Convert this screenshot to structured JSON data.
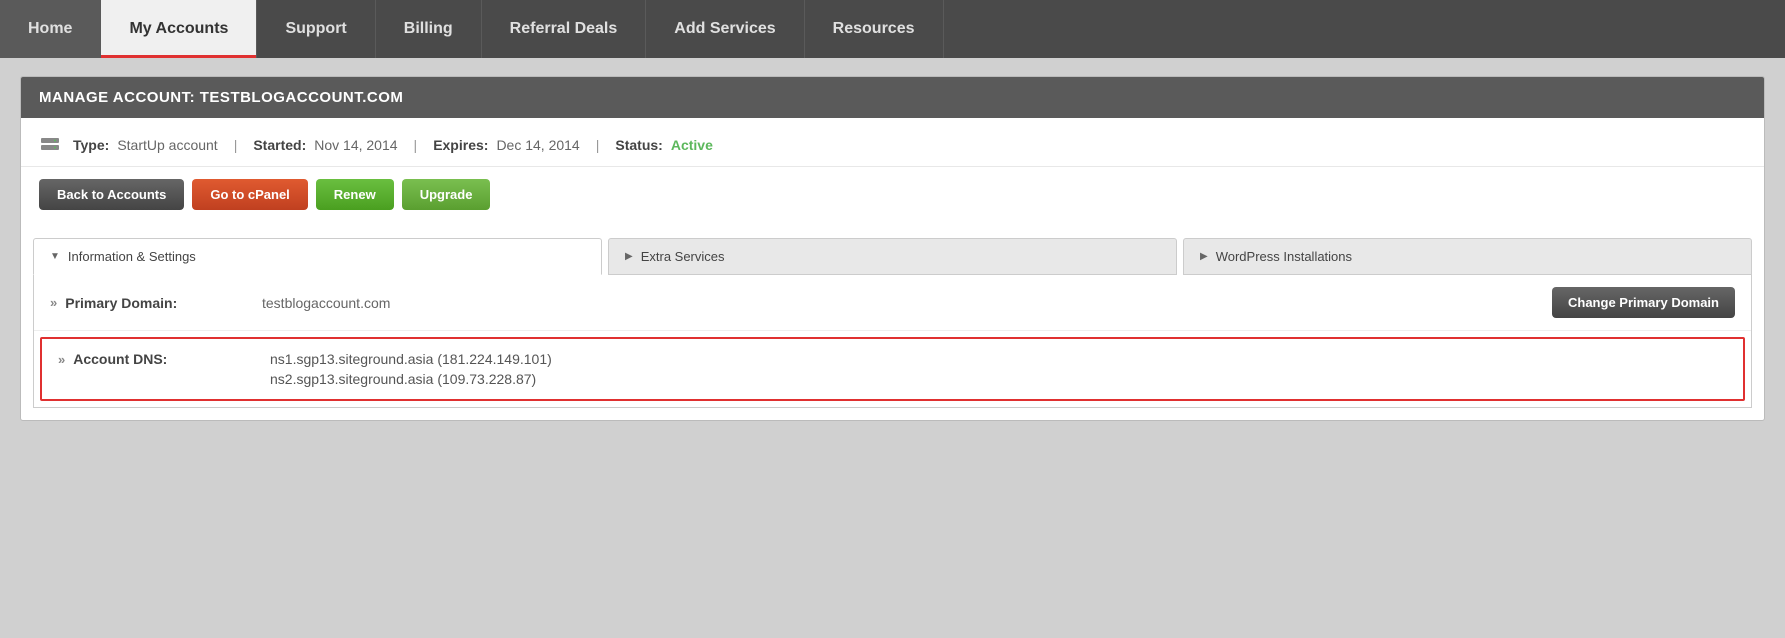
{
  "nav": {
    "tabs": [
      {
        "id": "home",
        "label": "Home",
        "active": false
      },
      {
        "id": "my-accounts",
        "label": "My Accounts",
        "active": true
      },
      {
        "id": "support",
        "label": "Support",
        "active": false
      },
      {
        "id": "billing",
        "label": "Billing",
        "active": false
      },
      {
        "id": "referral-deals",
        "label": "Referral Deals",
        "active": false
      },
      {
        "id": "add-services",
        "label": "Add Services",
        "active": false
      },
      {
        "id": "resources",
        "label": "Resources",
        "active": false
      }
    ]
  },
  "manage": {
    "header": "MANAGE ACCOUNT: TESTBLOGACCOUNT.COM",
    "type_label": "Type:",
    "type_value": "StartUp account",
    "started_label": "Started:",
    "started_value": "Nov 14, 2014",
    "expires_label": "Expires:",
    "expires_value": "Dec 14, 2014",
    "status_label": "Status:",
    "status_value": "Active"
  },
  "buttons": {
    "back_to_accounts": "Back to Accounts",
    "go_to_cpanel": "Go to cPanel",
    "renew": "Renew",
    "upgrade": "Upgrade"
  },
  "section_tabs": [
    {
      "id": "info-settings",
      "label": "Information & Settings",
      "active": true,
      "arrow": "▼"
    },
    {
      "id": "extra-services",
      "label": "Extra Services",
      "active": false,
      "arrow": "▶"
    },
    {
      "id": "wordpress-installations",
      "label": "WordPress Installations",
      "active": false,
      "arrow": "▶"
    }
  ],
  "domain_section": {
    "primary_domain_label": "Primary Domain:",
    "primary_domain_value": "testblogaccount.com",
    "change_domain_btn": "Change Primary Domain",
    "dns_label": "Account DNS:",
    "dns_values": [
      "ns1.sgp13.siteground.asia (181.224.149.101)",
      "ns2.sgp13.siteground.asia (109.73.228.87)"
    ]
  }
}
